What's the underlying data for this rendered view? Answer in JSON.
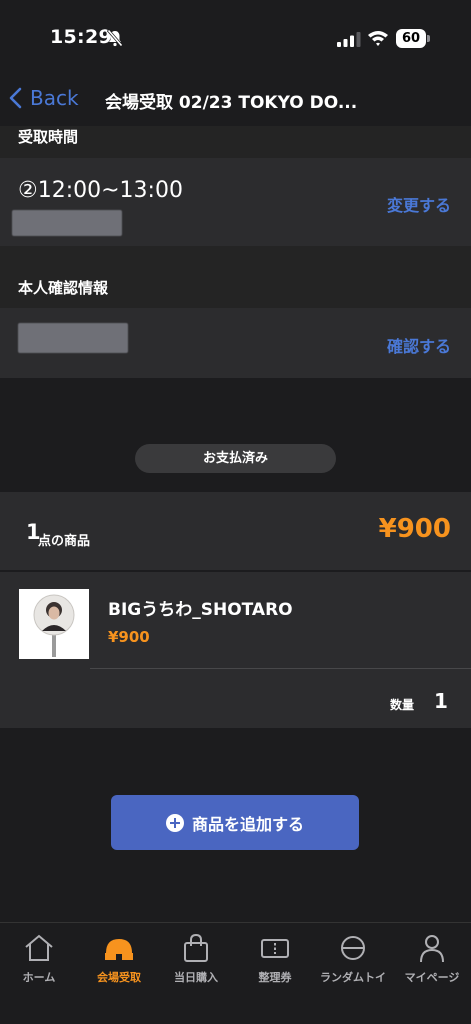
{
  "status_bar": {
    "time": "15:29",
    "battery": "60"
  },
  "nav": {
    "back_label": "Back",
    "title": "会場受取 02/23 TOKYO DO..."
  },
  "pickup_time": {
    "header": "受取時間",
    "slot": "②12:00~13:00",
    "change_label": "変更する"
  },
  "identity": {
    "header": "本人確認情報",
    "confirm_label": "確認する"
  },
  "payment_status": "お支払済み",
  "summary": {
    "count": "1",
    "suffix": "点の商品",
    "total": "¥900"
  },
  "item": {
    "name": "BIGうちわ_SHOTARO",
    "price": "¥900",
    "qty_label": "数量",
    "qty": "1"
  },
  "add_button_label": "商品を追加する",
  "tabs": [
    {
      "label": "ホーム",
      "icon": "home-icon",
      "active": false
    },
    {
      "label": "会場受取",
      "icon": "venue-icon",
      "active": true
    },
    {
      "label": "当日購入",
      "icon": "shopping-bag-icon",
      "active": false
    },
    {
      "label": "整理券",
      "icon": "ticket-icon",
      "active": false
    },
    {
      "label": "ランダムトイ",
      "icon": "random-toy-icon",
      "active": false
    },
    {
      "label": "マイページ",
      "icon": "person-icon",
      "active": false
    }
  ],
  "colors": {
    "accent_blue": "#4a78d6",
    "accent_orange": "#f7931e",
    "button_blue": "#4a66c1",
    "background": "#1c1c1e",
    "card": "#2c2c2e"
  }
}
